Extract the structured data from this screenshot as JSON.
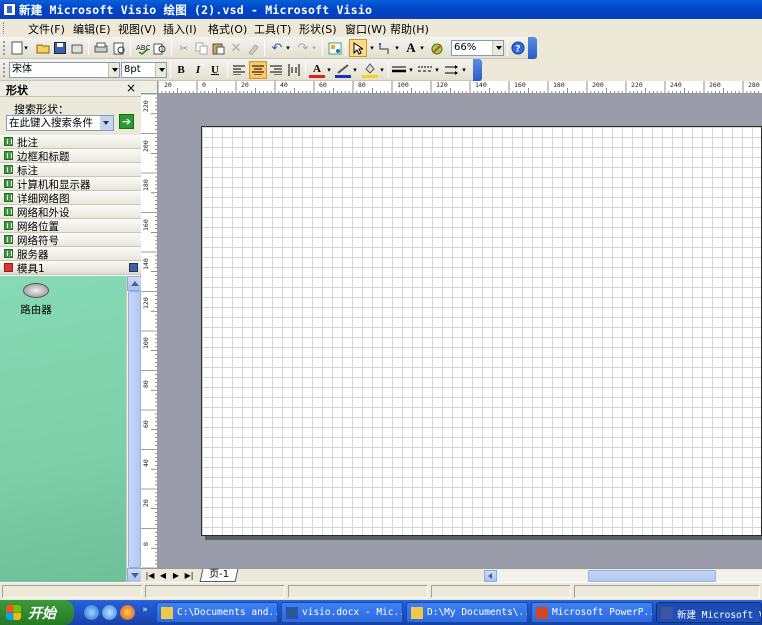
{
  "window": {
    "title": "新建 Microsoft Visio 绘图 (2).vsd - Microsoft Visio"
  },
  "menu": [
    "文件(F)",
    "编辑(E)",
    "视图(V)",
    "插入(I)",
    "格式(O)",
    "工具(T)",
    "形状(S)",
    "窗口(W)",
    "帮助(H)"
  ],
  "toolbar": {
    "zoom": "66%",
    "font": "宋体",
    "font_size": "8pt",
    "bold": "B",
    "italic": "I",
    "underline": "U"
  },
  "shapes_panel": {
    "title": "形状",
    "close": "×",
    "search_label": "搜索形状：",
    "search_placeholder": "在此键入搜索条件",
    "stencils": [
      "批注",
      "边框和标题",
      "标注",
      "计算机和显示器",
      "详细网络图",
      "网络和外设",
      "网络位置",
      "网络符号",
      "服务器"
    ],
    "active_stencil": "模具1",
    "master_shapes": [
      "路由器"
    ]
  },
  "rulers": {
    "top": [
      "20",
      "0",
      "20",
      "40",
      "60",
      "80",
      "100",
      "120",
      "140",
      "160",
      "180",
      "200",
      "220",
      "240",
      "260",
      "280"
    ],
    "left": [
      "220",
      "200",
      "180",
      "160",
      "140",
      "120",
      "100",
      "80",
      "60",
      "40",
      "20",
      "0"
    ]
  },
  "page_tabs": [
    "页-1"
  ],
  "taskbar": {
    "start": "开始",
    "tasks": [
      {
        "label": "C:\\Documents and...",
        "icon_color": "#f2c84b"
      },
      {
        "label": "visio.docx - Mic...",
        "icon_color": "#2b579a"
      },
      {
        "label": "D:\\My Documents\\...",
        "icon_color": "#f2c84b"
      },
      {
        "label": "Microsoft PowerP...",
        "icon_color": "#d24726"
      },
      {
        "label": "新建 Microsoft V...",
        "icon_color": "#3955a3",
        "active": true
      }
    ]
  }
}
